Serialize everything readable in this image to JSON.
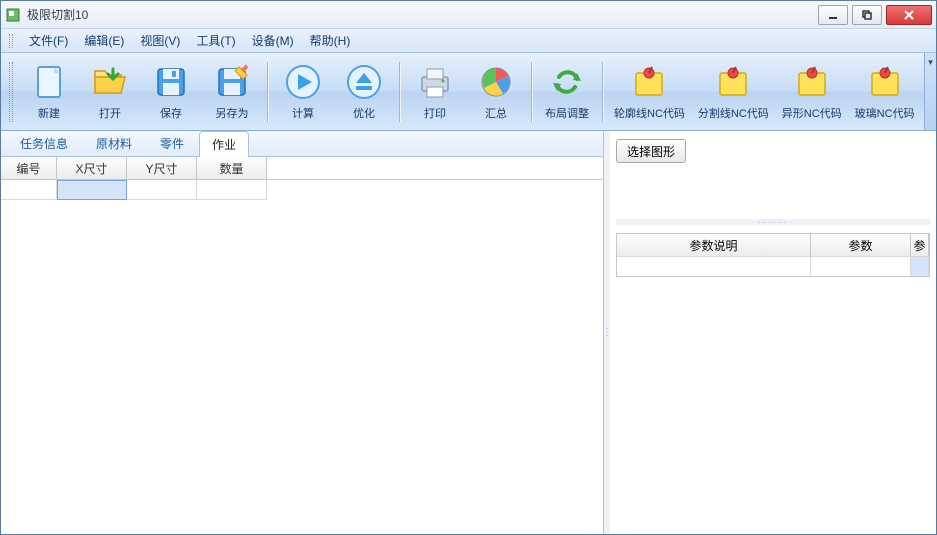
{
  "window": {
    "title": "极限切割10"
  },
  "menu": {
    "file": "文件(F)",
    "edit": "编辑(E)",
    "view": "视图(V)",
    "tools": "工具(T)",
    "device": "设备(M)",
    "help": "帮助(H)"
  },
  "toolbar": {
    "new": "新建",
    "open": "打开",
    "save": "保存",
    "saveas": "另存为",
    "calc": "计算",
    "optimize": "优化",
    "print": "打印",
    "summary": "汇总",
    "layout": "布局调整",
    "nc_outline": "轮廓线NC代码",
    "nc_split": "分割线NC代码",
    "nc_shape": "异形NC代码",
    "nc_glass": "玻璃NC代码"
  },
  "tabs": {
    "task": "任务信息",
    "material": "原材料",
    "parts": "零件",
    "job": "作业"
  },
  "grid": {
    "col_id": "编号",
    "col_x": "X尺寸",
    "col_y": "Y尺寸",
    "col_qty": "数量"
  },
  "right": {
    "select_shape": "选择图形",
    "param_desc": "参数说明",
    "param": "参数",
    "param_extra": "参"
  }
}
